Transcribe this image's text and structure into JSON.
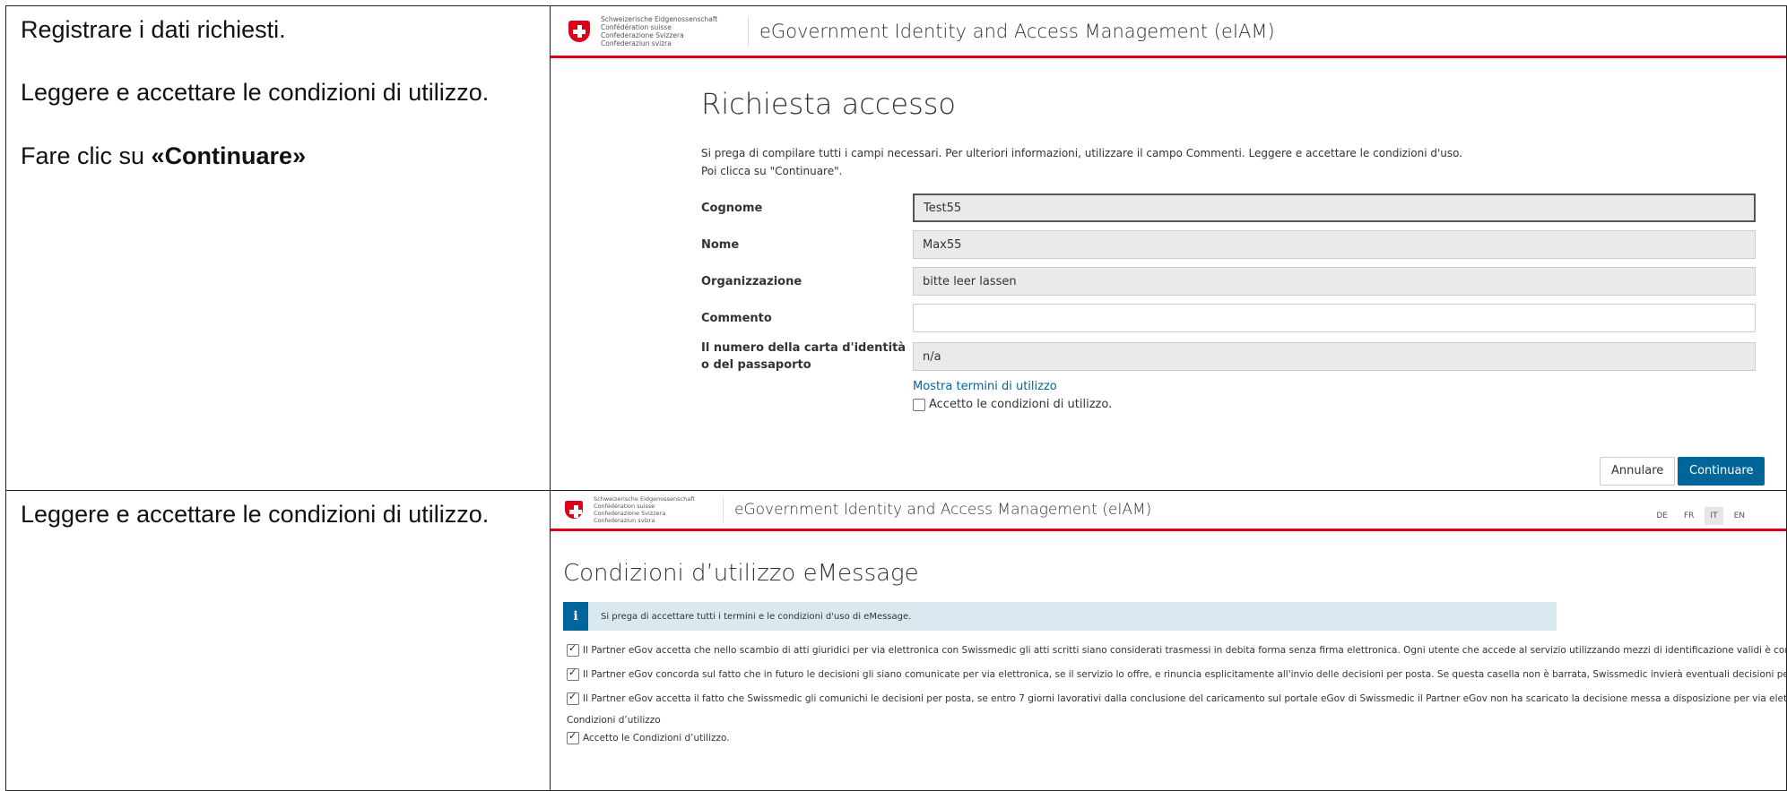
{
  "instructions": {
    "row1": [
      "Registrare i dati richiesti.",
      "Leggere e accettare le condizioni di utilizzo."
    ],
    "row1_click_prefix": "Fare clic su ",
    "row1_click_bold": "«Continuare»",
    "row2": "Leggere e accettare le condizioni di utilizzo."
  },
  "header": {
    "confederation_lines": [
      "Schweizerische Eidgenossenschaft",
      "Confédération suisse",
      "Confederazione Svizzera",
      "Confederaziun svizra"
    ],
    "app_title": "eGovernment Identity and Access Management (eIAM)"
  },
  "access_form": {
    "title": "Richiesta accesso",
    "intro_line1": "Si prega di compilare tutti i campi necessari. Per ulteriori informazioni, utilizzare il campo Commenti. Leggere e accettare le condizioni d'uso.",
    "intro_line2": "Poi clicca su \"Continuare\".",
    "fields": [
      {
        "label": "Cognome",
        "value": "Test55"
      },
      {
        "label": "Nome",
        "value": "Max55"
      },
      {
        "label": "Organizzazione",
        "value": "bitte leer lassen"
      },
      {
        "label": "Commento",
        "value": ""
      },
      {
        "label": "Il numero della carta d'identità o del passaporto",
        "value": "n/a"
      }
    ],
    "terms_link": "Mostra termini di utilizzo",
    "accept_label": "Accetto le condizioni di utilizzo.",
    "accept_checked": false,
    "cancel_label": "Annulare",
    "continue_label": "Continuare"
  },
  "terms_page": {
    "languages": [
      "DE",
      "FR",
      "IT",
      "EN"
    ],
    "active_language": "IT",
    "title": "Condizioni d’utilizzo eMessage",
    "info_icon": "i",
    "info_text": "Si prega di accettare tutti i termini e le condizioni d'uso di eMessage.",
    "conditions": [
      "Il Partner eGov accetta che nello scambio di atti giuridici per via elettronica con Swissmedic gli atti scritti siano considerati trasmessi in debita forma senza firma elettronica. Ogni utente che accede al servizio utilizzando mezzi di identificazione validi è consic",
      "Il Partner eGov concorda sul fatto che in futuro le decisioni gli siano comunicate per via elettronica, se il servizio lo offre, e rinuncia esplicitamente all'invio delle decisioni per posta. Se questa casella non è barrata, Swissmedic invierà eventuali decisioni per p",
      "Il Partner eGov accetta il fatto che Swissmedic gli comunichi le decisioni per posta, se entro 7 giorni lavorativi dalla conclusione del caricamento sul portale eGov di Swissmedic il Partner eGov non ha scaricato la decisione messa a disposizione per via elettro"
    ],
    "terms_link": "Condizioni d’utilizzo",
    "accept_label": "Accetto le Condizioni d’utilizzo."
  }
}
